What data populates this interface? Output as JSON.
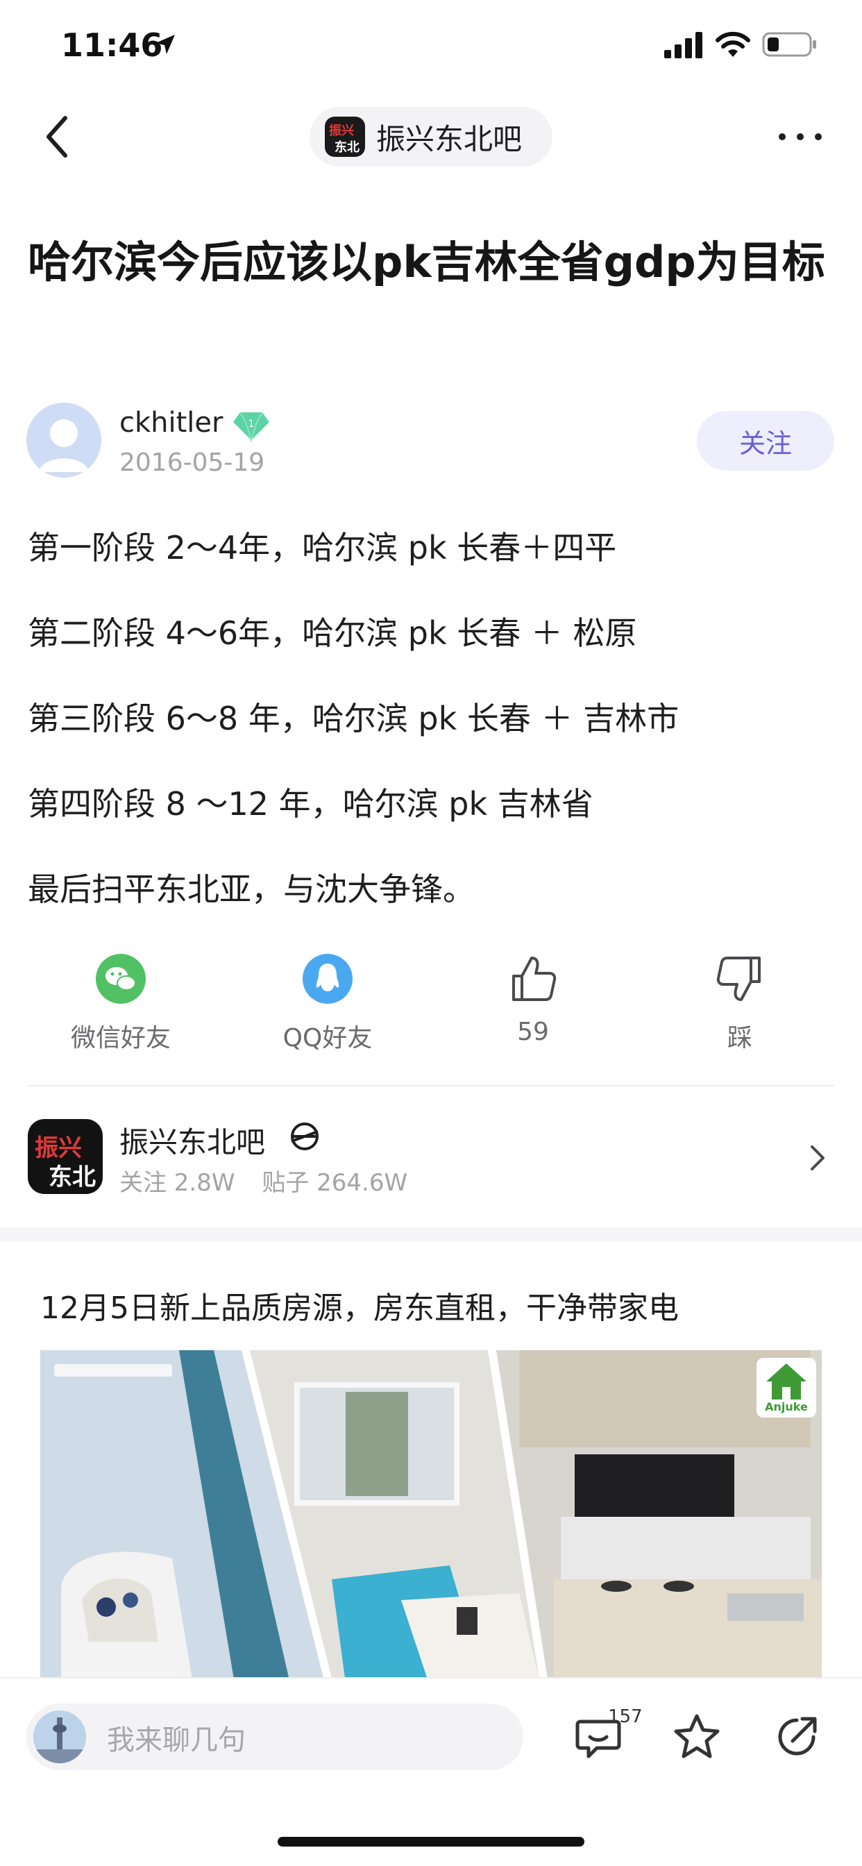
{
  "status_bar": {
    "time": "11:46"
  },
  "nav": {
    "forum_name": "振兴东北吧",
    "logo_text_top": "振兴",
    "logo_text_bottom": "东北"
  },
  "post": {
    "title": "哈尔滨今后应该以pk吉林全省gdp为目标",
    "author": {
      "name": "ckhitler",
      "badge_level": "1",
      "date": "2016-05-19"
    },
    "follow_label": "关注",
    "body_lines": [
      "第一阶段 2～4年，哈尔滨 pk 长春＋四平",
      "第二阶段 4～6年，哈尔滨 pk 长春 ＋ 松原",
      "第三阶段 6～8 年，哈尔滨 pk 长春 ＋ 吉林市",
      "第四阶段 8 ～12 年，哈尔滨 pk 吉林省",
      "最后扫平东北亚，与沈大争锋。"
    ]
  },
  "actions": {
    "wechat_label": "微信好友",
    "qq_label": "QQ好友",
    "like_count": "59",
    "dislike_label": "踩"
  },
  "forum_card": {
    "name": "振兴东北吧",
    "followers": "关注 2.8W",
    "posts": "贴子 264.6W"
  },
  "ad": {
    "title": "12月5日新上品质房源，房东直租，干净带家电",
    "badge_label": "Anjuke"
  },
  "bottom_bar": {
    "input_placeholder": "我来聊几句",
    "comment_count": "157"
  },
  "icons": [
    "back-icon",
    "more-icon",
    "wechat-icon",
    "qq-icon",
    "thumbs-up-icon",
    "thumbs-down-icon",
    "forum-tag-icon",
    "chevron-right-icon",
    "comment-icon",
    "star-icon",
    "share-icon"
  ],
  "colors": {
    "accent": "#6b5fd6",
    "follow_bg": "#eeeefd",
    "wechat_green": "#52c164",
    "qq_blue": "#4aa8f0",
    "diamond": "#5cd3a5",
    "secondary_text": "#a3a3a8"
  }
}
